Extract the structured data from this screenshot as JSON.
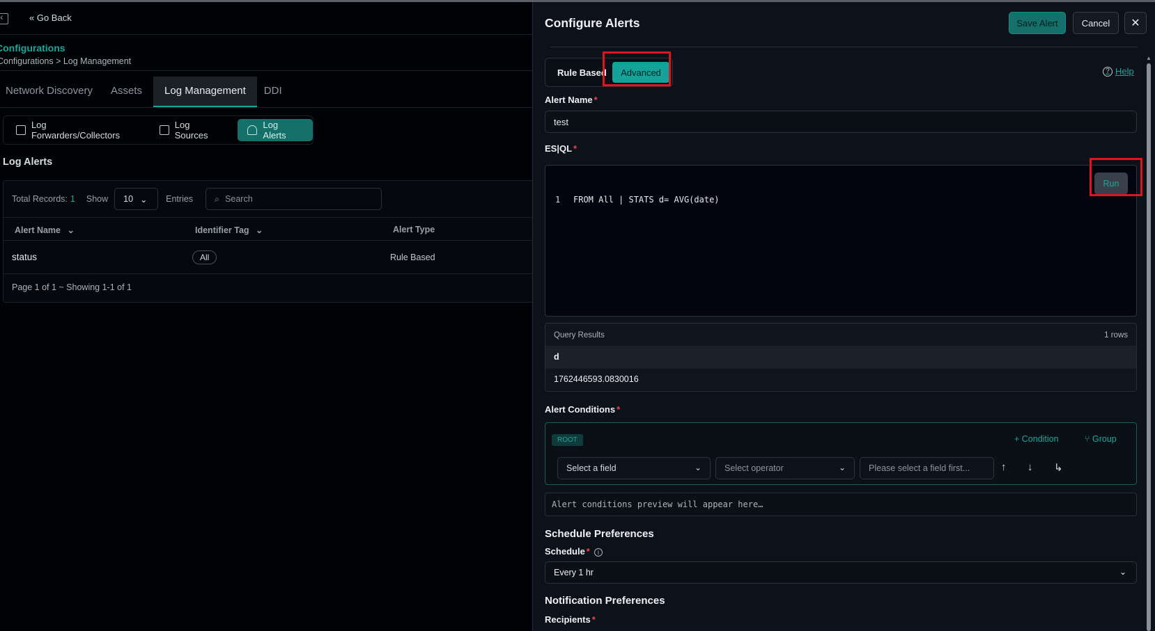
{
  "nav": {
    "go_back": "« Go Back"
  },
  "breadcrumb": {
    "title": "Configurations",
    "path": "Configurations > Log Management"
  },
  "tabs": [
    "Network Discovery",
    "Assets",
    "Log Management",
    "DDI"
  ],
  "subtabs": [
    "Log Forwarders/Collectors",
    "Log Sources",
    "Log Alerts"
  ],
  "log_alerts": {
    "title": "Log Alerts",
    "total_label": "Total Records:",
    "total_count": "1",
    "show_label": "Show",
    "show_value": "10",
    "entries_label": "Entries",
    "search_placeholder": "Search",
    "columns": [
      "Alert Name",
      "Identifier Tag",
      "Alert Type"
    ],
    "rows": [
      {
        "name": "status",
        "tag": "All",
        "type": "Rule Based"
      }
    ],
    "footer": "Page 1 of 1 ~ Showing 1-1 of 1"
  },
  "drawer": {
    "title": "Configure Alerts",
    "save_label": "Save Alert",
    "cancel_label": "Cancel",
    "close_symbol": "✕",
    "mode_rule": "Rule Based",
    "mode_advanced": "Advanced",
    "help_label": "Help",
    "alert_name_label": "Alert Name",
    "alert_name_value": "test",
    "esql_label": "ES|QL",
    "run_label": "Run",
    "code_line_no": "1",
    "code": "FROM All | STATS d= AVG(date)",
    "results_title": "Query Results",
    "results_rows": "1 rows",
    "results_column": "d",
    "results_value": "1762446593.0830016",
    "conditions_label": "Alert Conditions",
    "root_badge": "ROOT",
    "add_condition": "+ Condition",
    "add_group": "Group",
    "field_placeholder": "Select a field",
    "operator_placeholder": "Select operator",
    "value_placeholder": "Please select a field first...",
    "preview_text": "Alert conditions preview will appear here…",
    "schedule_section": "Schedule Preferences",
    "schedule_label": "Schedule",
    "schedule_value": "Every 1 hr",
    "notification_section": "Notification Preferences",
    "recipients_label": "Recipients"
  },
  "colors": {
    "accent": "#1aa79b",
    "highlight": "#e3131b",
    "required": "#e0484e"
  }
}
